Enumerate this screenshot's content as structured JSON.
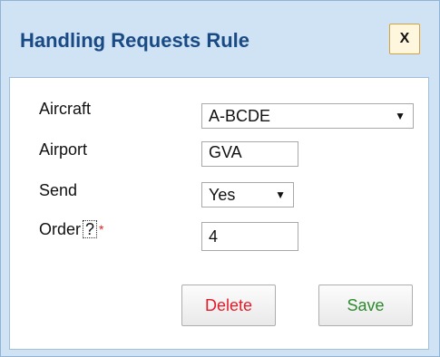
{
  "dialog": {
    "title": "Handling Requests Rule",
    "close_label": "X"
  },
  "form": {
    "aircraft": {
      "label": "Aircraft",
      "value": "A-BCDE"
    },
    "airport": {
      "label": "Airport",
      "value": "GVA"
    },
    "send": {
      "label": "Send",
      "value": "Yes"
    },
    "order": {
      "label": "Order",
      "help": "?",
      "required_mark": "*",
      "value": "4"
    }
  },
  "icons": {
    "dropdown": "▼"
  },
  "buttons": {
    "delete_label": "Delete",
    "save_label": "Save"
  },
  "colors": {
    "title": "#1a4a84",
    "delete": "#e31b2a",
    "save": "#2d8a2d",
    "required": "#dd2222",
    "dialog_bg": "#cfe3f5"
  }
}
